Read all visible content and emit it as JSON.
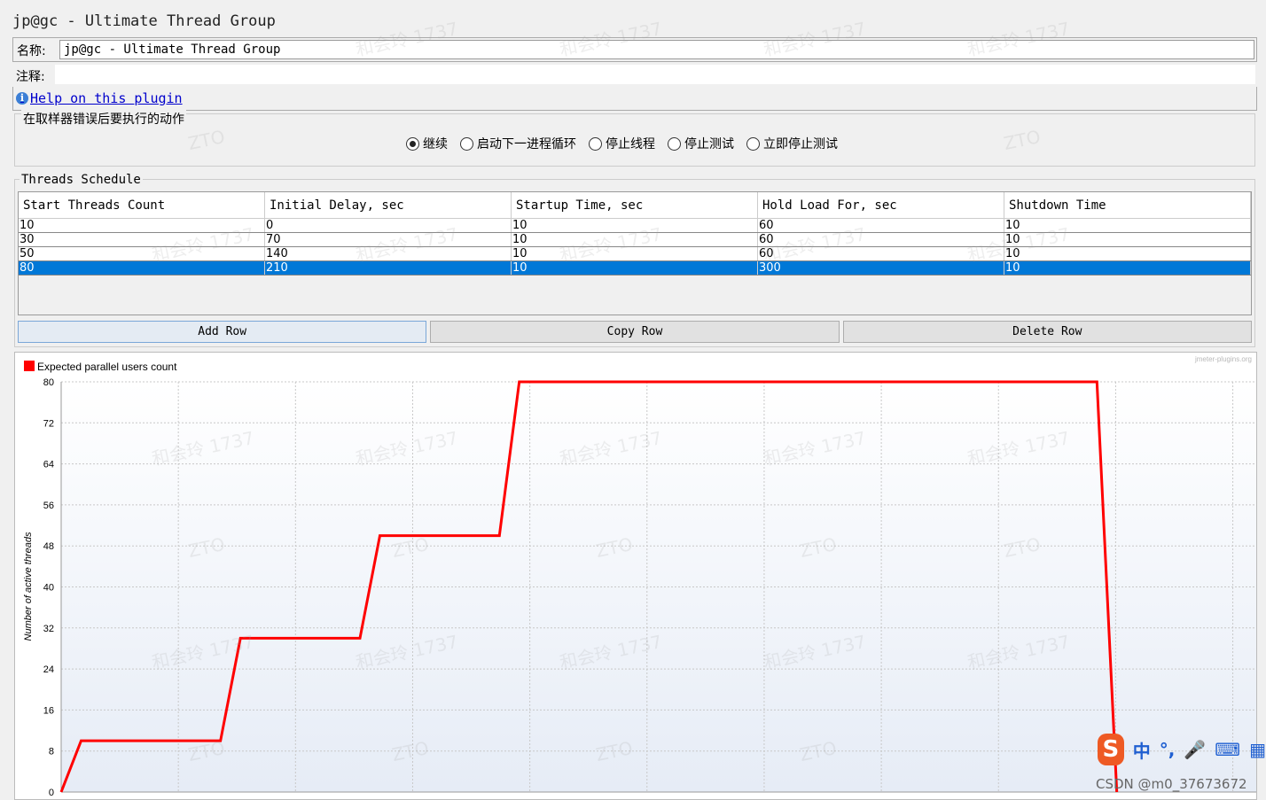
{
  "panel": {
    "title": "jp@gc - Ultimate Thread Group",
    "name_label": "名称:",
    "name_value": "jp@gc - Ultimate Thread Group",
    "comment_label": "注释:",
    "comment_value": "",
    "help_link": "Help on this plugin"
  },
  "error_action": {
    "legend": "在取样器错误后要执行的动作",
    "options": [
      {
        "label": "继续",
        "selected": true
      },
      {
        "label": "启动下一进程循环",
        "selected": false
      },
      {
        "label": "停止线程",
        "selected": false
      },
      {
        "label": "停止测试",
        "selected": false
      },
      {
        "label": "立即停止测试",
        "selected": false
      }
    ]
  },
  "schedule": {
    "legend": "Threads Schedule",
    "columns": [
      "Start Threads Count",
      "Initial Delay, sec",
      "Startup Time, sec",
      "Hold Load For, sec",
      "Shutdown Time"
    ],
    "rows": [
      [
        "10",
        "0",
        "10",
        "60",
        "10"
      ],
      [
        "30",
        "70",
        "10",
        "60",
        "10"
      ],
      [
        "50",
        "140",
        "10",
        "60",
        "10"
      ],
      [
        "80",
        "210",
        "10",
        "300",
        "10"
      ]
    ],
    "selected_row": 3,
    "buttons": {
      "add": "Add Row",
      "copy": "Copy Row",
      "delete": "Delete Row"
    }
  },
  "chart_data": {
    "type": "line",
    "legend_entry": "Expected parallel users count",
    "brand": "jmeter-plugins.org",
    "ylabel": "Number of active threads",
    "yticks": [
      0,
      8,
      16,
      24,
      32,
      40,
      48,
      56,
      64,
      72,
      80
    ],
    "ylim": [
      0,
      80
    ],
    "xlim": [
      0,
      600
    ],
    "grid": true,
    "legend_placement": "top-left",
    "line_color": "#ff0000",
    "series": [
      {
        "x": [
          0,
          10,
          80,
          90,
          150,
          160,
          220,
          230,
          520,
          530
        ],
        "y": [
          0,
          10,
          10,
          30,
          30,
          50,
          50,
          80,
          80,
          0
        ]
      }
    ]
  },
  "watermarks": {
    "user": "和会玲 1737",
    "brand": "ZTO"
  },
  "ime": {
    "logo": "S",
    "mode": "中",
    "punct": "°,",
    "mic": "🎤",
    "keyboard": "⌨",
    "grid": "▦"
  },
  "footer_credit": "CSDN @m0_37673672"
}
